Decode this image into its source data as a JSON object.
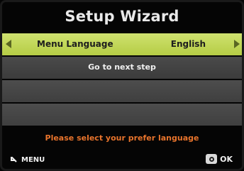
{
  "header": {
    "title": "Setup Wizard"
  },
  "menu": {
    "items": [
      {
        "label": "Menu Language",
        "value": "English"
      },
      {
        "label": "Go to next step"
      }
    ]
  },
  "prompt": "Please select your prefer language",
  "footer": {
    "menu_label": "MENU",
    "ok_label": "OK"
  },
  "icons": {
    "left_arrow": "left-arrow-icon",
    "right_arrow": "right-arrow-icon",
    "back": "back-arrow-icon",
    "ok": "ok-button-icon"
  },
  "colors": {
    "selected_row": "#c3d75a",
    "prompt_text": "#e8742c",
    "row_background": "#444444"
  }
}
